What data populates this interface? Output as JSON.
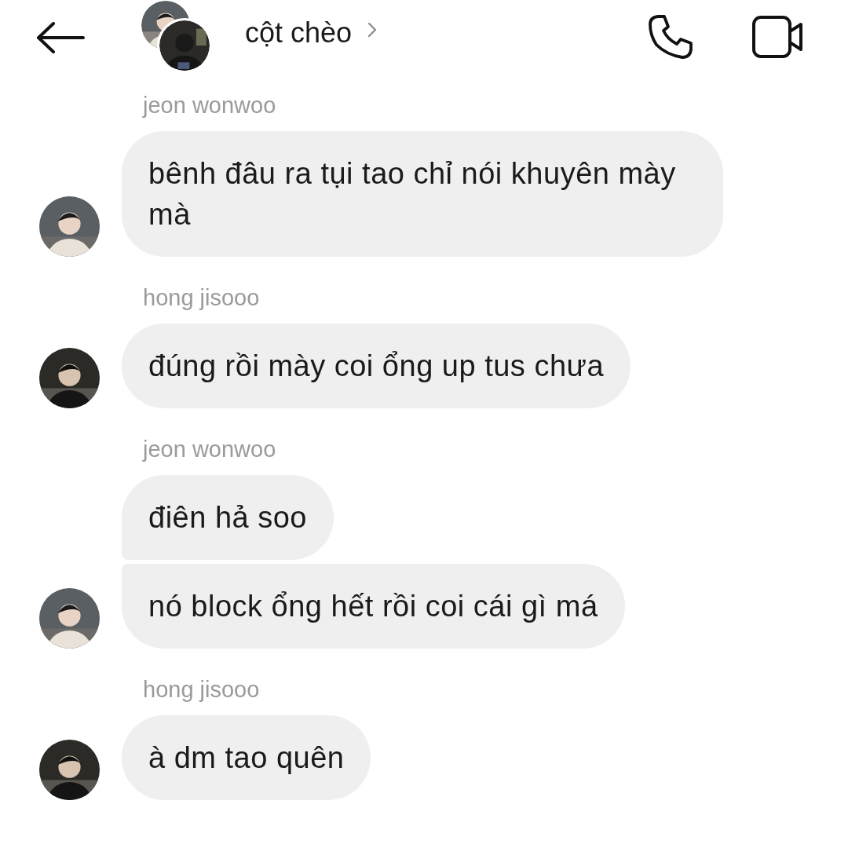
{
  "header": {
    "title": "cột chèo"
  },
  "groups": [
    {
      "sender": "jeon wonwoo",
      "bubbles": [
        "bênh đâu ra tụi tao chỉ nói khuyên mày mà"
      ]
    },
    {
      "sender": "hong jisooo",
      "bubbles": [
        "đúng rồi mày coi ổng up tus chưa"
      ]
    },
    {
      "sender": "jeon wonwoo",
      "bubbles": [
        "điên hả soo",
        "nó block ổng hết rồi coi cái gì má"
      ]
    },
    {
      "sender": "hong jisooo",
      "bubbles": [
        "à dm tao quên"
      ]
    }
  ]
}
